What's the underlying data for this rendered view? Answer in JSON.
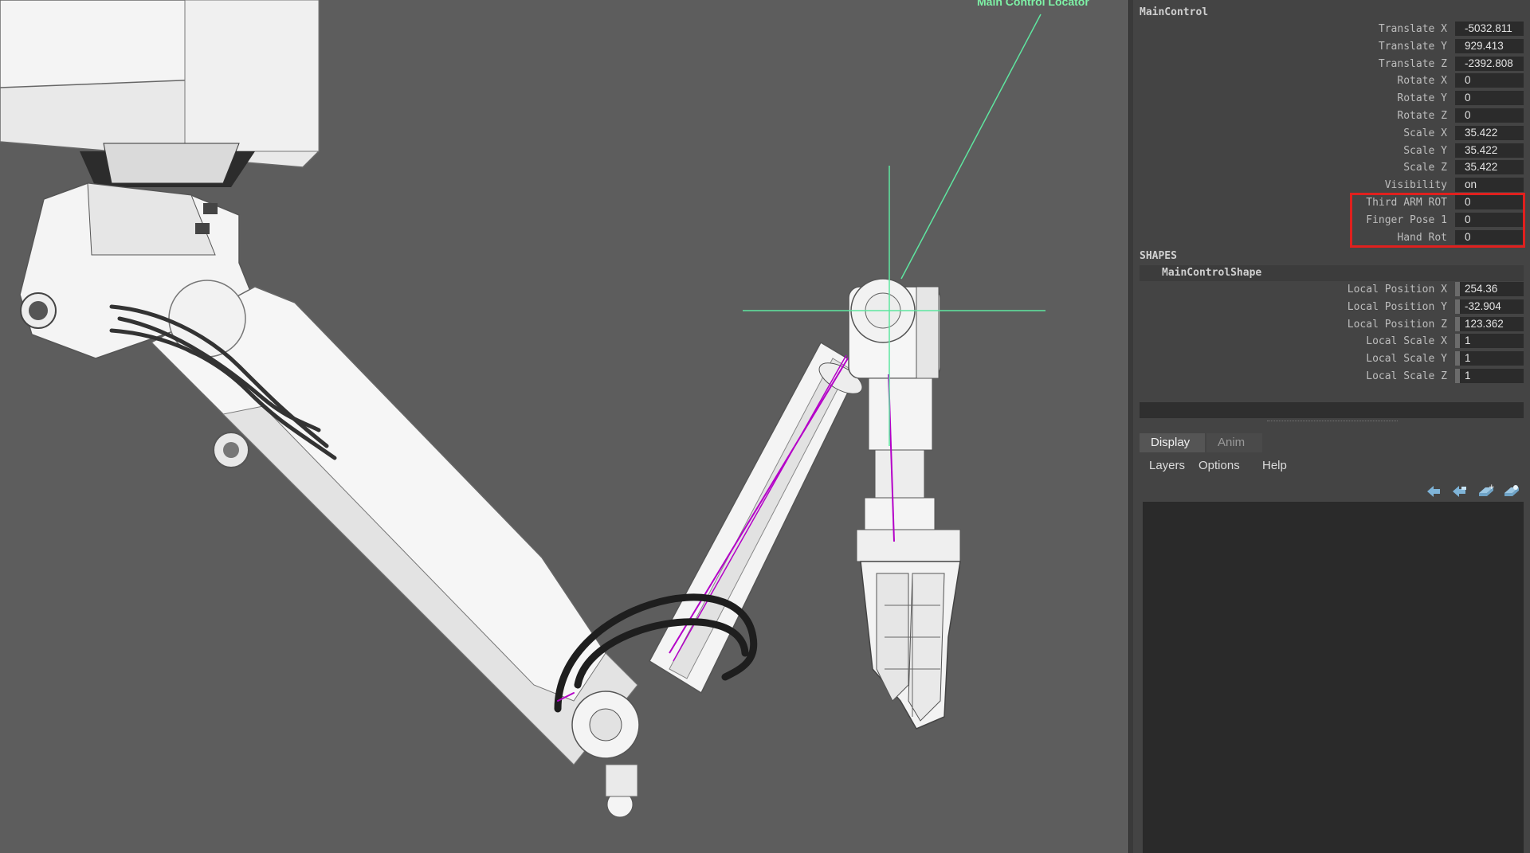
{
  "viewport": {
    "locator_label": "Main Control Locator"
  },
  "channel_box": {
    "object_name": "MainControl",
    "attributes": [
      {
        "label": "Translate X",
        "value": "-5032.811"
      },
      {
        "label": "Translate Y",
        "value": "929.413"
      },
      {
        "label": "Translate Z",
        "value": "-2392.808"
      },
      {
        "label": "Rotate X",
        "value": "0"
      },
      {
        "label": "Rotate Y",
        "value": "0"
      },
      {
        "label": "Rotate Z",
        "value": "0"
      },
      {
        "label": "Scale X",
        "value": "35.422"
      },
      {
        "label": "Scale Y",
        "value": "35.422"
      },
      {
        "label": "Scale Z",
        "value": "35.422"
      },
      {
        "label": "Visibility",
        "value": "on"
      },
      {
        "label": "Third ARM ROT",
        "value": "0"
      },
      {
        "label": "Finger Pose 1",
        "value": "0"
      },
      {
        "label": "Hand Rot",
        "value": "0"
      }
    ],
    "highlight_color": "#e0201e",
    "shapes_title": "SHAPES",
    "shape_name": "MainControlShape",
    "shape_attributes": [
      {
        "label": "Local Position X",
        "value": "254.36"
      },
      {
        "label": "Local Position Y",
        "value": "-32.904"
      },
      {
        "label": "Local Position Z",
        "value": "123.362"
      },
      {
        "label": "Local Scale X",
        "value": "1"
      },
      {
        "label": "Local Scale Y",
        "value": "1"
      },
      {
        "label": "Local Scale Z",
        "value": "1"
      }
    ]
  },
  "layer_editor": {
    "tabs": [
      {
        "label": "Display",
        "active": true
      },
      {
        "label": "Anim",
        "active": false
      }
    ],
    "menus": [
      "Layers",
      "Options",
      "Help"
    ],
    "tools": [
      "move-layer-up-icon",
      "move-layer-down-icon",
      "new-layer-icon",
      "new-layer-from-selected-icon"
    ]
  }
}
